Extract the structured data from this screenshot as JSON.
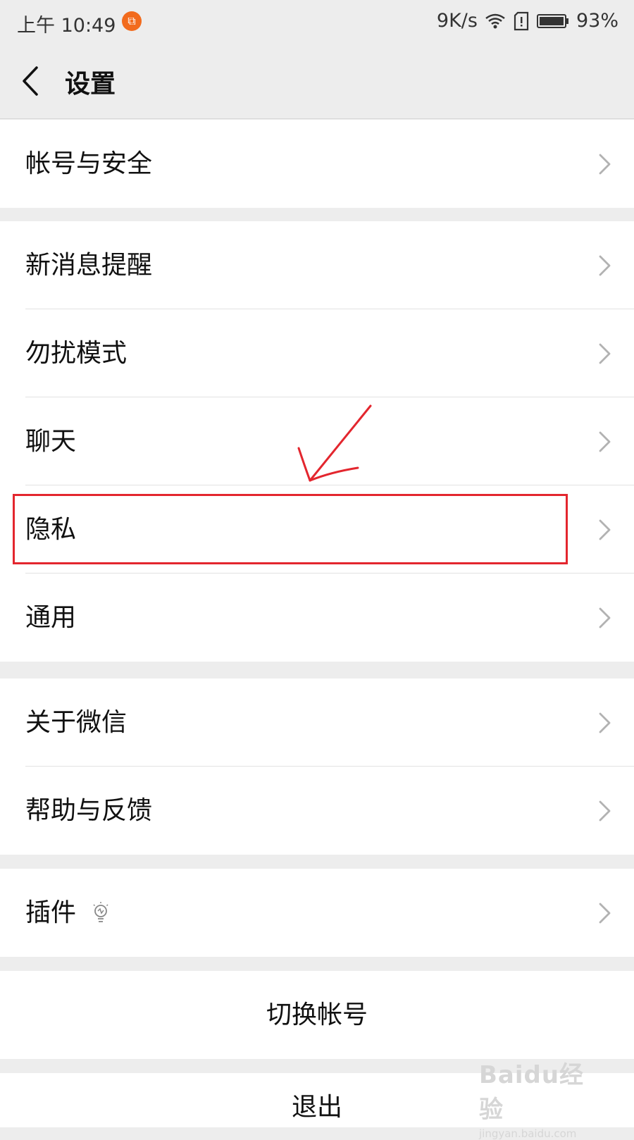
{
  "status_bar": {
    "time": "上午 10:49",
    "speed": "9K/s",
    "battery": "93%",
    "icons": [
      "crop-notification-icon",
      "wifi-icon",
      "sim-alert-icon",
      "battery-icon"
    ]
  },
  "header": {
    "title": "设置",
    "back_icon": "chevron-left-icon"
  },
  "groups": [
    {
      "items": [
        {
          "label": "帐号与安全"
        }
      ]
    },
    {
      "items": [
        {
          "label": "新消息提醒"
        },
        {
          "label": "勿扰模式"
        },
        {
          "label": "聊天"
        },
        {
          "label": "隐私"
        },
        {
          "label": "通用"
        }
      ]
    },
    {
      "items": [
        {
          "label": "关于微信"
        },
        {
          "label": "帮助与反馈"
        }
      ]
    },
    {
      "items": [
        {
          "label": "插件",
          "icon": "lightbulb-icon"
        }
      ]
    }
  ],
  "actions": {
    "switch_account": "切换帐号",
    "logout": "退出"
  },
  "annotation": {
    "highlight_color": "#e3262e",
    "highlighted_item": "隐私"
  },
  "watermark": {
    "logo": "Baidu经验",
    "url": "jingyan.baidu.com"
  },
  "colors": {
    "background": "#ededed",
    "row": "#ffffff",
    "notification_badge": "#f26b1d"
  }
}
